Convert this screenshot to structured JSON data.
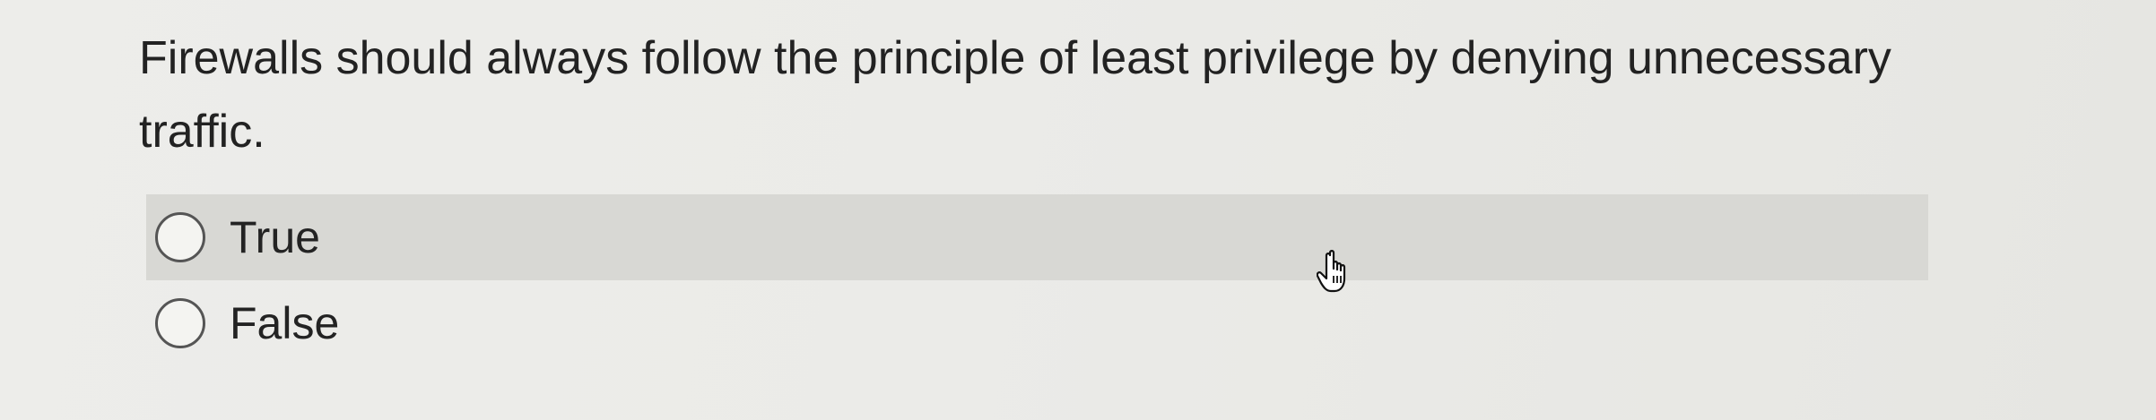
{
  "question": {
    "text": "Firewalls should always follow the principle of least privilege by denying unnecessary traffic."
  },
  "options": [
    {
      "label": "True",
      "selected": false
    },
    {
      "label": "False",
      "selected": false
    }
  ],
  "cursor": {
    "icon": "hand-pointer-icon"
  }
}
